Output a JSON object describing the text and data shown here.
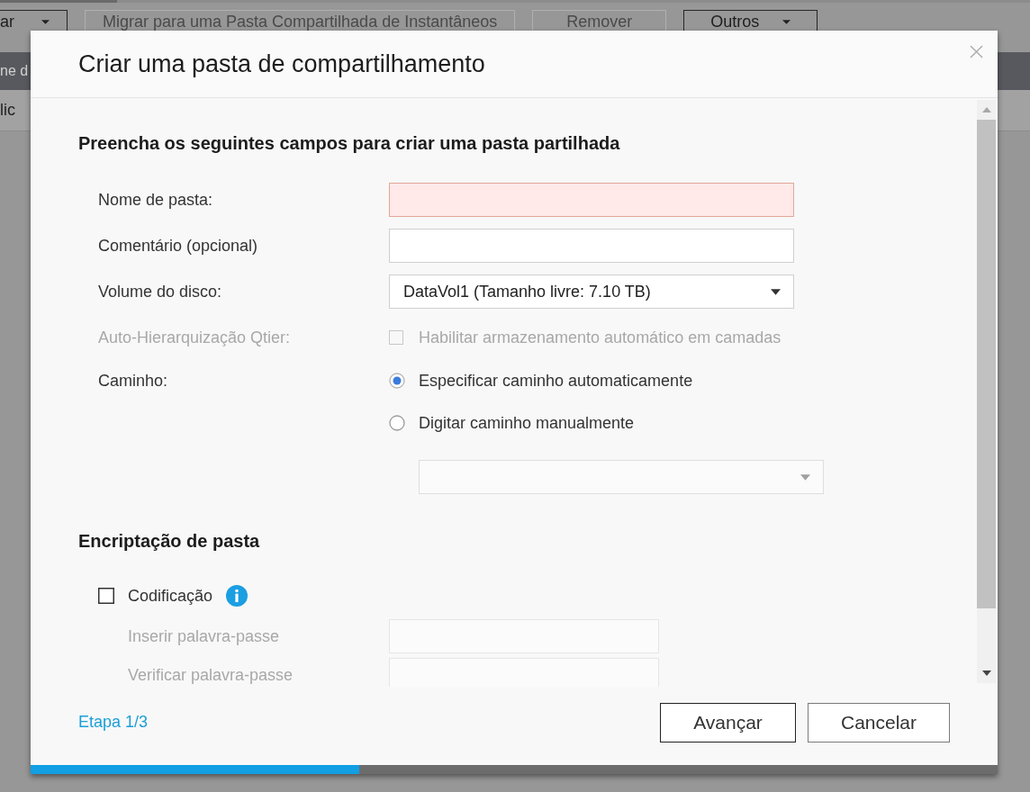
{
  "background": {
    "toolbar": [
      {
        "label": "ar",
        "kind": "dropdown",
        "disabled": false
      },
      {
        "label": "Migrar para uma Pasta Compartilhada de Instantâneos",
        "kind": "button",
        "disabled": true
      },
      {
        "label": "Remover",
        "kind": "button",
        "disabled": true
      },
      {
        "label": "Outros",
        "kind": "dropdown",
        "disabled": false
      }
    ],
    "table": {
      "column_1": "ne d",
      "rows": [
        "lic"
      ]
    }
  },
  "dialog": {
    "title": "Criar uma pasta de compartilhamento",
    "heading": "Preencha os seguintes campos para criar uma pasta partilhada",
    "fields": [
      {
        "kind": "text",
        "label": "Nome de pasta:",
        "invalid": true
      },
      {
        "kind": "text",
        "label": "Comentário (opcional)",
        "invalid": false
      },
      {
        "kind": "select",
        "label": "Volume do disco:",
        "value": "DataVol1 (Tamanho livre: 7.10 TB)"
      },
      {
        "kind": "checkbox",
        "label": "Auto-Hierarquização Qtier:",
        "disabled": true,
        "option": "Habilitar armazenamento automático em camadas",
        "checked": false
      },
      {
        "kind": "radio",
        "label": "Caminho:",
        "options": [
          {
            "label": "Especificar caminho automaticamente",
            "selected": true
          },
          {
            "label": "Digitar caminho manualmente",
            "selected": false
          }
        ],
        "path_select": {
          "disabled": true
        }
      }
    ],
    "encryption": {
      "heading": "Encriptação de pasta",
      "option": {
        "label": "Codificação",
        "checked": false
      },
      "fields": [
        {
          "label": "Inserir palavra-passe",
          "disabled": true
        },
        {
          "label": "Verificar palavra-passe",
          "disabled": true
        }
      ]
    },
    "step": "Etapa 1/3",
    "buttons": [
      {
        "label": "Avançar",
        "kind": "primary"
      },
      {
        "label": "Cancelar",
        "kind": "secondary"
      }
    ],
    "progress": {
      "level": 0.34
    }
  }
}
